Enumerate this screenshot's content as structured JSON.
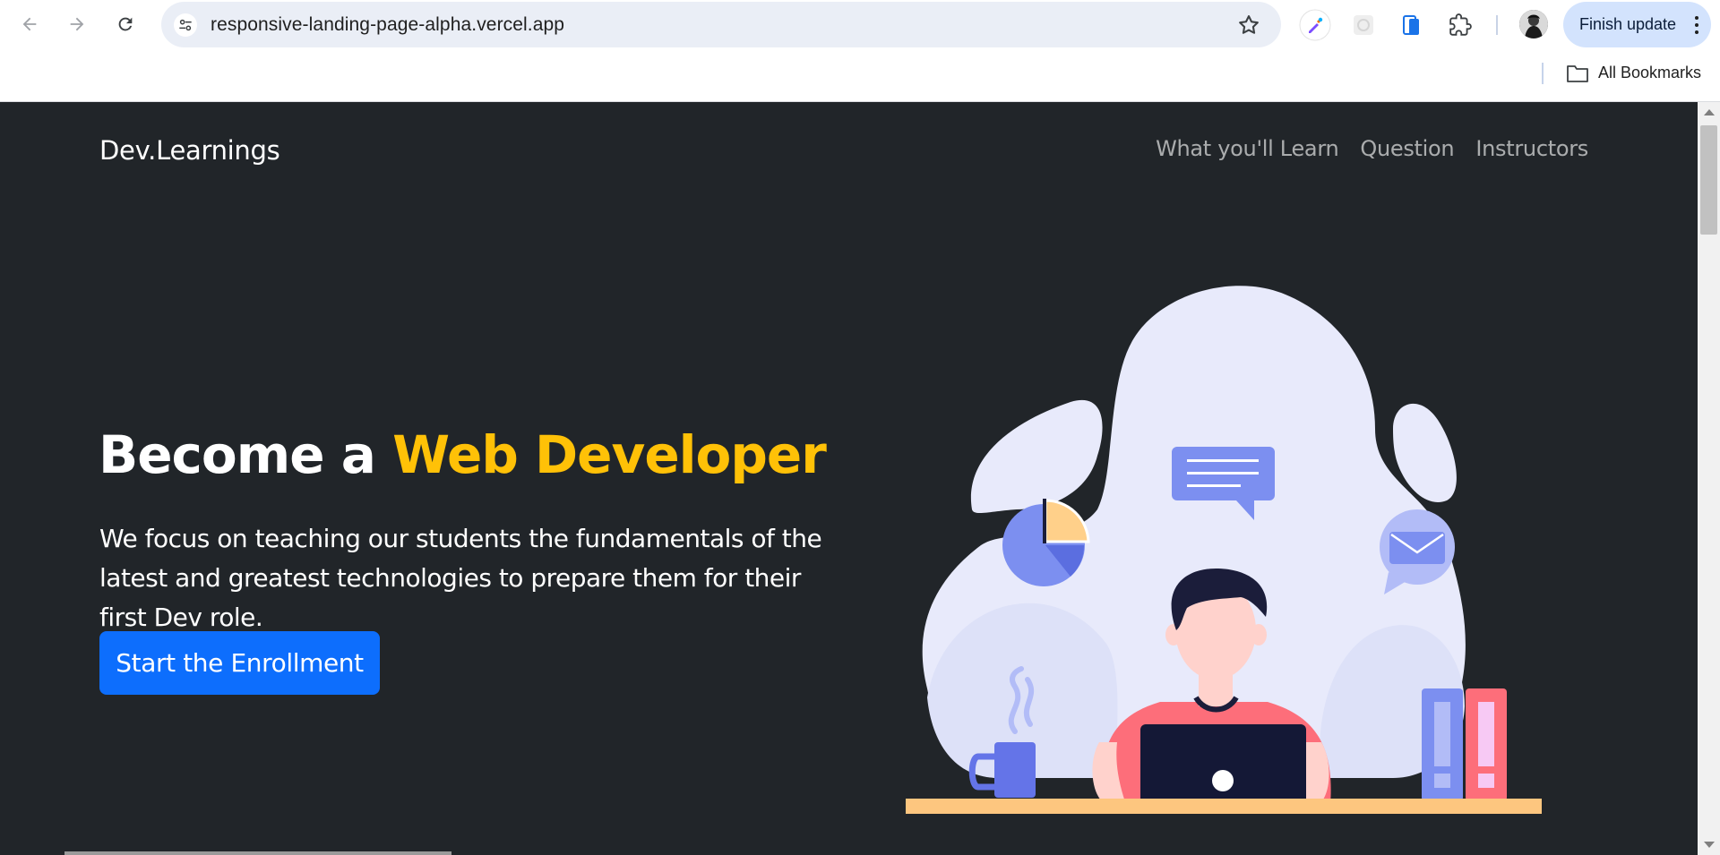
{
  "browser": {
    "url": "responsive-landing-page-alpha.vercel.app",
    "update_button": "Finish update",
    "bookmarks_label": "All Bookmarks"
  },
  "page": {
    "brand": "Dev.Learnings",
    "nav": [
      {
        "label": "What you'll Learn"
      },
      {
        "label": "Question"
      },
      {
        "label": "Instructors"
      }
    ],
    "hero": {
      "title_prefix": "Become a ",
      "title_accent": "Web Developer",
      "lead": "We focus on teaching our students the fundamentals of the latest and greatest technologies to prepare them for their first Dev role.",
      "cta": "Start the Enrollment"
    }
  },
  "colors": {
    "background": "#212529",
    "accent": "#ffc107",
    "primary": "#0d6efd"
  }
}
